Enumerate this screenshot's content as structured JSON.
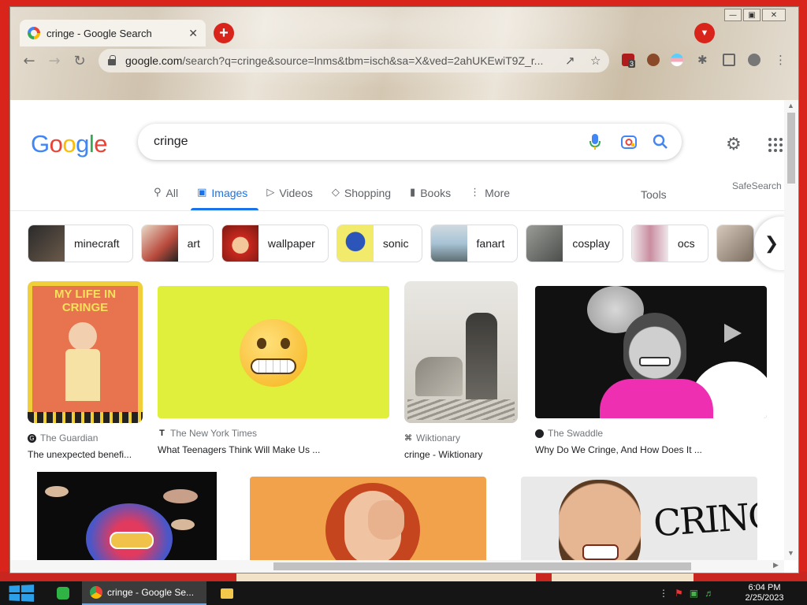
{
  "browser": {
    "tab_title": "cringe - Google Search",
    "url_domain": "google.com",
    "url_path": "/search?q=cringe&source=lnms&tbm=isch&sa=X&ved=2ahUKEwiT9Z_r...",
    "extension_badge": "3"
  },
  "google": {
    "logo_letters": [
      "G",
      "o",
      "o",
      "g",
      "l",
      "e"
    ],
    "logo_colors": [
      "#4285f4",
      "#ea4335",
      "#fbbc05",
      "#4285f4",
      "#34a853",
      "#ea4335"
    ],
    "search_query": "cringe",
    "nav_tabs": [
      {
        "label": "All",
        "icon": "search-icon",
        "active": false
      },
      {
        "label": "Images",
        "icon": "image-icon",
        "active": true
      },
      {
        "label": "Videos",
        "icon": "video-icon",
        "active": false
      },
      {
        "label": "Shopping",
        "icon": "tag-icon",
        "active": false
      },
      {
        "label": "Books",
        "icon": "book-icon",
        "active": false
      },
      {
        "label": "More",
        "icon": "more-vert-icon",
        "active": false
      }
    ],
    "tools_label": "Tools",
    "safesearch_label": "SafeSearch",
    "chips": [
      {
        "label": "minecraft",
        "color": "#3a3a3a"
      },
      {
        "label": "art",
        "color": "#b84a3c"
      },
      {
        "label": "wallpaper",
        "color": "#c8281e"
      },
      {
        "label": "sonic",
        "color": "#2b55b8"
      },
      {
        "label": "fanart",
        "color": "#a7c3d6"
      },
      {
        "label": "cosplay",
        "color": "#6b6e6a"
      },
      {
        "label": "ocs",
        "color": "#d4c8cc"
      },
      {
        "label": "",
        "color": "#7a6b5e"
      }
    ],
    "results": [
      {
        "source": "The Guardian",
        "title": "The unexpected benefi...",
        "img_text": "MY LIFE IN CRINGE"
      },
      {
        "source": "The New York Times",
        "title": "What Teenagers Think Will Make Us ..."
      },
      {
        "source": "Wiktionary",
        "title": "cringe - Wiktionary"
      },
      {
        "source": "The Swaddle",
        "title": "Why Do We Cringe, And How Does It ..."
      }
    ],
    "row2_img_text": "CRINGE"
  },
  "taskbar": {
    "app_title": "cringe - Google Se...",
    "time": "6:04 PM",
    "date": "2/25/2023"
  },
  "colors": {
    "google_blue": "#1a73e8",
    "desktop_red": "#d8241a",
    "taskbar": "#151515"
  }
}
